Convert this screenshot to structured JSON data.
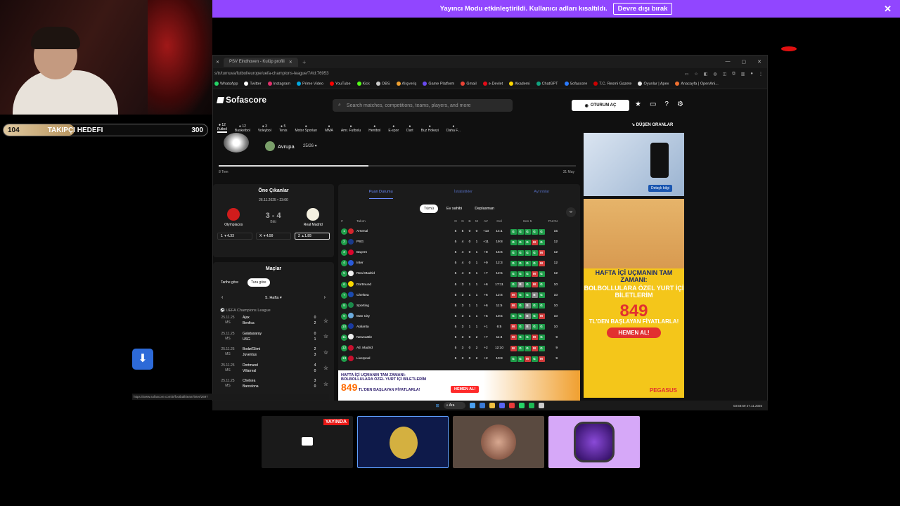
{
  "banner": {
    "text": "Yayıncı Modu etkinleştirildi. Kullanıcı adları kısaltıldı.",
    "button": "Devre dışı bırak"
  },
  "goal": {
    "current": "104",
    "label": "TAKIPÇI HEDEFI",
    "target": "300",
    "progress": 0.347
  },
  "browser": {
    "tab": "PSV Eindhoven - Kulüp profili",
    "url": "s/tr/turnuva/futbol/europe/uefa-champions-league/7#id:76953",
    "bookmarks": [
      "WhatsApp",
      "Twitter",
      "Instagram",
      "Prime Video",
      "YouTube",
      "Kick",
      "OBS",
      "Alışveriş",
      "Game Platform",
      "Gmail",
      "e-Devlet",
      "Akademi",
      "ChatGPT",
      "Sofascore",
      "T.C. Resmi Gazete",
      "Oyunlar | Apex",
      "Anacayfa | OpenAni..."
    ]
  },
  "site": {
    "logo": "Sofascore",
    "search_placeholder": "Search matches, competitions, teams, players, and more",
    "login": "OTURUM AÇ",
    "sports": [
      {
        "count": "12",
        "label": "Futbol"
      },
      {
        "count": "12",
        "label": "Basketbol"
      },
      {
        "count": "3",
        "label": "Voleybol"
      },
      {
        "count": "5",
        "label": "Tenis"
      },
      {
        "count": "",
        "label": "Motor Sporları"
      },
      {
        "count": "",
        "label": "MMA"
      },
      {
        "count": "",
        "label": "Amr. Futbolu"
      },
      {
        "count": "",
        "label": "Hentbol"
      },
      {
        "count": "",
        "label": "E-spor"
      },
      {
        "count": "",
        "label": "Dart"
      },
      {
        "count": "",
        "label": "Buz Hokeyi"
      },
      {
        "count": "",
        "label": "Daha F..."
      }
    ],
    "dropping_odds": "DÜŞEN ORANLAR"
  },
  "hero": {
    "region": "Avrupa",
    "season": "25/26",
    "start": "8 Tem",
    "end": "31 May",
    "progress": 0.42
  },
  "highlights": {
    "title": "Öne Çıkanlar",
    "datetime": "26.11.2025 • 23:00",
    "home": "Olympiacos",
    "away": "Real Madrid",
    "score": "3 - 4",
    "status": "Bitti",
    "odds": [
      {
        "k": "1",
        "v": "4.33"
      },
      {
        "k": "X",
        "v": "4.50"
      },
      {
        "k": "2",
        "v": "1.85"
      }
    ]
  },
  "matches": {
    "title": "Maçlar",
    "by_date": "Tarihe göre",
    "by_round": "Tura göre",
    "week": "5. Hafta",
    "league": "UEFA Champions League",
    "rows": [
      {
        "date": "25.11.25",
        "st": "MS",
        "home": "Ajax",
        "away": "Benfica",
        "hs": "0",
        "as": "2"
      },
      {
        "date": "25.11.25",
        "st": "MS",
        "home": "Galatasaray",
        "away": "USG",
        "hs": "0",
        "as": "1"
      },
      {
        "date": "25.11.25",
        "st": "MS",
        "home": "Bodø/Glimt",
        "away": "Juventus",
        "hs": "2",
        "as": "3"
      },
      {
        "date": "25.11.25",
        "st": "MS",
        "home": "Dortmund",
        "away": "Villarreal",
        "hs": "4",
        "as": "0"
      },
      {
        "date": "25.11.25",
        "st": "MS",
        "home": "Chelsea",
        "away": "Barcelona",
        "hs": "3",
        "as": "0"
      }
    ]
  },
  "standings": {
    "tabs": [
      "Puan Durumu",
      "İstatistikler",
      "Ayrıntılar"
    ],
    "filters": [
      "Tümü",
      "Ev sahibi",
      "Deplasman"
    ],
    "headers": {
      "n": "#",
      "team": "Takım",
      "o": "O",
      "g": "G",
      "b": "B",
      "m": "M",
      "av": "AV",
      "gol": "Gol",
      "form": "Son 5",
      "p": "PUAN"
    },
    "rows": [
      {
        "n": "1",
        "team": "Arsenal",
        "o": "5",
        "g": "5",
        "b": "0",
        "m": "0",
        "av": "+13",
        "gol": "14:1",
        "form": "GGGGG",
        "p": "15",
        "c": "#d3262d"
      },
      {
        "n": "2",
        "team": "PSG",
        "o": "5",
        "g": "4",
        "b": "0",
        "m": "1",
        "av": "+11",
        "gol": "19:8",
        "form": "GGGMG",
        "p": "12",
        "c": "#1a3a8a"
      },
      {
        "n": "3",
        "team": "Bayern",
        "o": "5",
        "g": "4",
        "b": "0",
        "m": "1",
        "av": "+8",
        "gol": "15:6",
        "form": "GGGGM",
        "p": "12",
        "c": "#dc052d"
      },
      {
        "n": "4",
        "team": "Inter",
        "o": "5",
        "g": "4",
        "b": "0",
        "m": "1",
        "av": "+9",
        "gol": "12:3",
        "form": "GGGGM",
        "p": "12",
        "c": "#2a5ad8"
      },
      {
        "n": "5",
        "team": "Real Madrid",
        "o": "5",
        "g": "4",
        "b": "0",
        "m": "1",
        "av": "+7",
        "gol": "12:5",
        "form": "GGGMG",
        "p": "12",
        "c": "#f0f0f0"
      },
      {
        "n": "6",
        "team": "Dortmund",
        "o": "5",
        "g": "3",
        "b": "1",
        "m": "1",
        "av": "+6",
        "gol": "17:11",
        "form": "GBGMG",
        "p": "10",
        "c": "#f8d600"
      },
      {
        "n": "7",
        "team": "Chelsea",
        "o": "5",
        "g": "3",
        "b": "1",
        "m": "1",
        "av": "+6",
        "gol": "12:6",
        "form": "MGGBG",
        "p": "10",
        "c": "#1a4ab0"
      },
      {
        "n": "8",
        "team": "Sporting",
        "o": "5",
        "g": "3",
        "b": "1",
        "m": "1",
        "av": "+6",
        "gol": "11:5",
        "form": "MGBGG",
        "p": "10",
        "c": "#1a8a4a"
      },
      {
        "n": "9",
        "team": "Man City",
        "o": "5",
        "g": "3",
        "b": "1",
        "m": "1",
        "av": "+5",
        "gol": "10:5",
        "form": "GGBGM",
        "p": "10",
        "c": "#6cabdd"
      },
      {
        "n": "10",
        "team": "Atalanta",
        "o": "5",
        "g": "3",
        "b": "1",
        "m": "1",
        "av": "+1",
        "gol": "6:5",
        "form": "MGBGG",
        "p": "10",
        "c": "#1a3aa0"
      },
      {
        "n": "11",
        "team": "Newcastle",
        "o": "5",
        "g": "3",
        "b": "0",
        "m": "2",
        "av": "+7",
        "gol": "11:4",
        "form": "MGGMG",
        "p": "9",
        "c": "#eeeeee"
      },
      {
        "n": "12",
        "team": "Atl. Madrid",
        "o": "5",
        "g": "3",
        "b": "0",
        "m": "2",
        "av": "+2",
        "gol": "12:10",
        "form": "MGGMG",
        "p": "9",
        "c": "#c8102e"
      },
      {
        "n": "13",
        "team": "Liverpool",
        "o": "5",
        "g": "3",
        "b": "0",
        "m": "2",
        "av": "+2",
        "gol": "10:8",
        "form": "GGMGM",
        "p": "9",
        "c": "#c8102e"
      }
    ]
  },
  "ads": {
    "top_button": "Detaylı bilgi",
    "side_line1": "HAFTA İÇİ UÇMANIN TAM ZAMANI:",
    "side_line2": "BOLBOLLULARA ÖZEL YURT İÇİ BİLETLERİM",
    "price": "849",
    "side_line3": "TL'DEN BAŞLAYAN FİYATLARLA!",
    "cta": "HEMEN AL!",
    "brand": "PEGASUS",
    "bottom_line1": "HAFTA İÇİ UÇMANIN TAM ZAMANI:",
    "bottom_line2": "BOLBOLLULARA ÖZEL YURT İÇİ BİLETLERİM",
    "bottom_price_text": "TL'DEN BAŞLAYAN FİYATLARLA!"
  },
  "statusbar": "https://www.sofascore.com/tr/football/team/inter/2697",
  "taskbar": {
    "search": "Ara",
    "time": "03:58:59",
    "date": "27.11.2025"
  },
  "stream": {
    "live_badge": "YAYINDA"
  }
}
